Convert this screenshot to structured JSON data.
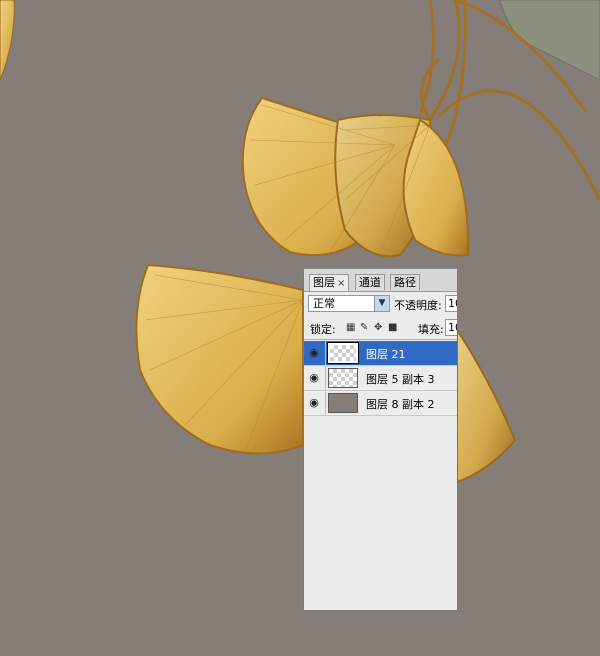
{
  "colors": {
    "canvas_bg": "#857d78",
    "leaf_light": "#e8c66a",
    "leaf_dark": "#b07d22",
    "selection": "#316ac5"
  },
  "panel": {
    "tabs": [
      {
        "label": "图层",
        "active": true,
        "close": "×"
      },
      {
        "label": "通道",
        "active": false
      },
      {
        "label": "路径",
        "active": false
      }
    ],
    "blend_mode": "正常",
    "opacity_label": "不透明度:",
    "opacity_value": "10",
    "lock_label": "锁定:",
    "lock_icons": [
      "lock-transparent-icon",
      "lock-paint-icon",
      "lock-move-icon",
      "lock-all-icon"
    ],
    "fill_label": "填充:",
    "fill_value": "10",
    "layers": [
      {
        "name": "图层 21",
        "selected": true,
        "thumb": "transparent"
      },
      {
        "name": "图层 5 副本 3",
        "selected": false,
        "thumb": "transparent-art"
      },
      {
        "name": "图层 8 副本 2",
        "selected": false,
        "thumb": "solid"
      }
    ]
  }
}
